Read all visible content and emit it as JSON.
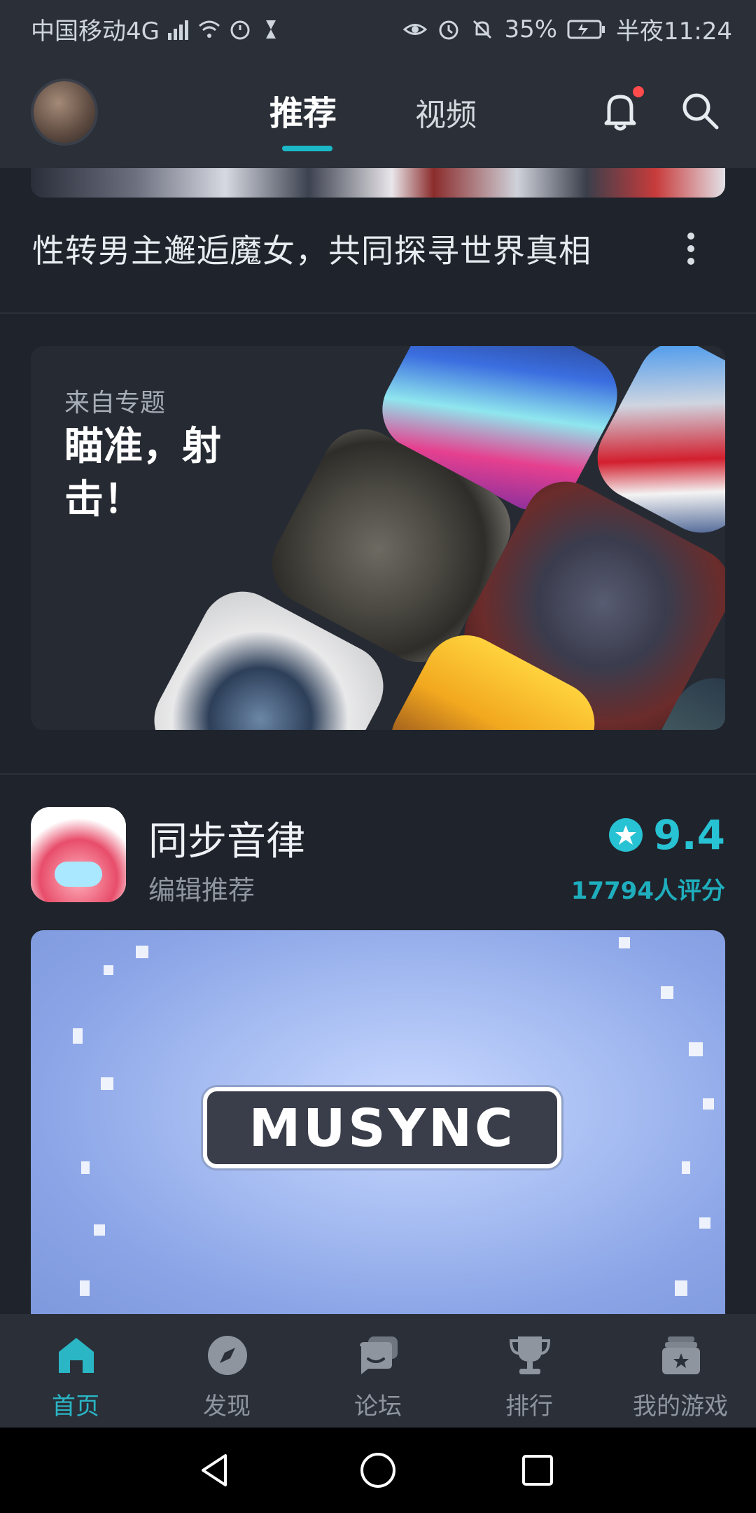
{
  "status_bar": {
    "carrier": "中国移动4G",
    "battery": "35%",
    "time": "半夜11:24"
  },
  "header": {
    "tabs": [
      {
        "label": "推荐",
        "active": true
      },
      {
        "label": "视频",
        "active": false
      }
    ],
    "accent_color": "#1bb8c7"
  },
  "feed": {
    "video_item": {
      "title": "性转男主邂逅魔女，共同探寻世界真相"
    },
    "topic_card": {
      "from_label": "来自专题",
      "title": "瞄准，射击！"
    },
    "game_card": {
      "name": "同步音律",
      "subtitle": "编辑推荐",
      "rating": "9.4",
      "rating_count": "17794人评分",
      "banner_logo": "MUSYNC"
    }
  },
  "bottom_nav": {
    "items": [
      {
        "label": "首页",
        "icon": "home-icon",
        "active": true
      },
      {
        "label": "发现",
        "icon": "compass-icon",
        "active": false
      },
      {
        "label": "论坛",
        "icon": "forum-icon",
        "active": false
      },
      {
        "label": "排行",
        "icon": "trophy-icon",
        "active": false
      },
      {
        "label": "我的游戏",
        "icon": "my-games-icon",
        "active": false
      }
    ]
  }
}
